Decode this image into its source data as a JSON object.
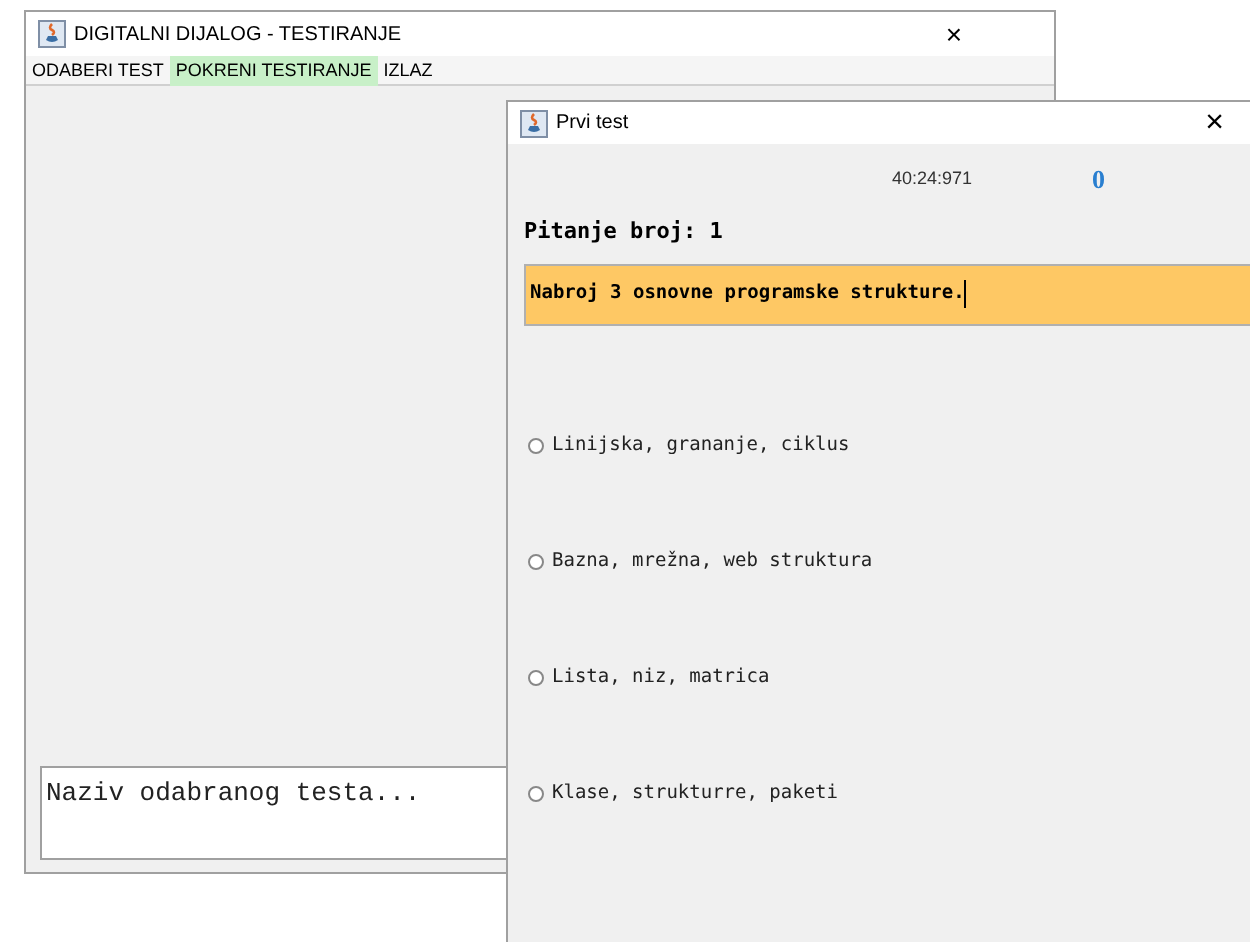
{
  "main_window": {
    "title": "DIGITALNI DIJALOG - TESTIRANJE",
    "close": "×",
    "menu": [
      {
        "label": "ODABERI TEST",
        "selected": false
      },
      {
        "label": "POKRENI TESTIRANJE",
        "selected": true
      },
      {
        "label": "IZLAZ",
        "selected": false
      }
    ],
    "test_name": {
      "value": "Naziv odabranog testa..."
    }
  },
  "dialog": {
    "title": "Prvi test",
    "close": "×",
    "timer": "40:24:971",
    "score": "0",
    "question_label": "Pitanje broj: 1",
    "question": {
      "value": "Nabroj 3 osnovne programske strukture."
    },
    "answers": [
      {
        "label": "Linijska, grananje, ciklus",
        "selected": false
      },
      {
        "label": "Bazna, mrežna, web struktura",
        "selected": false
      },
      {
        "label": "Lista, niz, matrica",
        "selected": false
      },
      {
        "label": "Klase, strukturre, paketi",
        "selected": false
      }
    ]
  }
}
